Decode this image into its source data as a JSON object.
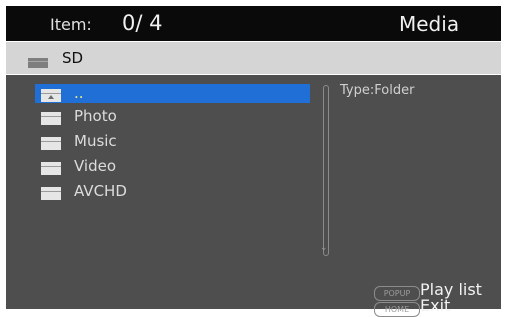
{
  "header": {
    "item_label": "Item:",
    "item_count": "0/ 4",
    "title": "Media"
  },
  "path": {
    "icon": "folder-icon",
    "label": "SD"
  },
  "list": {
    "items": [
      {
        "label": "..",
        "icon": "folder-up-icon",
        "selected": true
      },
      {
        "label": "Photo",
        "icon": "folder-icon",
        "selected": false
      },
      {
        "label": "Music",
        "icon": "folder-icon",
        "selected": false
      },
      {
        "label": "Video",
        "icon": "folder-icon",
        "selected": false
      },
      {
        "label": "AVCHD",
        "icon": "folder-icon",
        "selected": false
      }
    ]
  },
  "info": {
    "type_text": "Type:Folder"
  },
  "footer": {
    "popup_key": "POPUP",
    "popup_action": "Play list",
    "home_key": "HOME",
    "home_action": "Exit"
  },
  "colors": {
    "selection": "#1f6fd6",
    "selected_text": "#f4f07a",
    "panel_bg": "#4e4e4e",
    "header_bg": "#0a0a0a",
    "path_bg": "#d5d5d5"
  }
}
